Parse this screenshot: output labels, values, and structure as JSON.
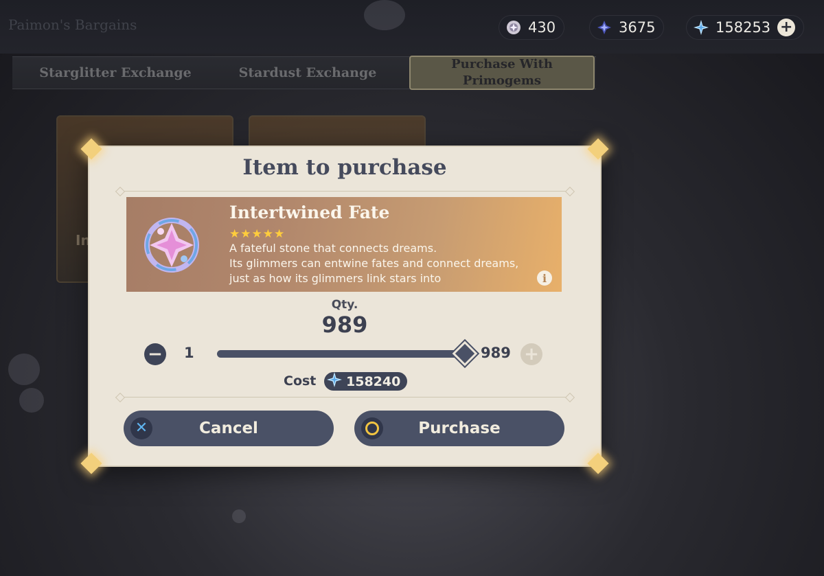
{
  "shop": {
    "title": "Paimon's Bargains"
  },
  "currencies": [
    {
      "icon": "masterless-starglitter-icon",
      "value": "430"
    },
    {
      "icon": "masterless-stardust-icon",
      "value": "3675"
    },
    {
      "icon": "primogem-icon",
      "value": "158253"
    }
  ],
  "tabs": [
    {
      "label": "Starglitter Exchange",
      "active": false
    },
    {
      "label": "Stardust Exchange",
      "active": false
    },
    {
      "label": "Purchase With Primogems",
      "active": true
    }
  ],
  "background_card_label": "In",
  "dialog": {
    "title": "Item to purchase",
    "item": {
      "name": "Intertwined Fate",
      "stars": "★★★★★",
      "description": "A fateful stone that connects dreams.\nIts glimmers can entwine fates and connect dreams, just as how its glimmers link stars into",
      "icon": "intertwined-fate-icon"
    },
    "qty_label": "Qty.",
    "qty_value": "989",
    "slider": {
      "min": "1",
      "max": "989",
      "fraction": 1.0
    },
    "cost_label": "Cost",
    "cost_value": "158240",
    "cancel_label": "Cancel",
    "purchase_label": "Purchase"
  },
  "colors": {
    "dialog_bg": "#ebe5d9",
    "button_bg": "#4a5166",
    "title_text": "#454a5c",
    "star": "#ffcd3c",
    "accent_glow": "#f3d07c"
  }
}
